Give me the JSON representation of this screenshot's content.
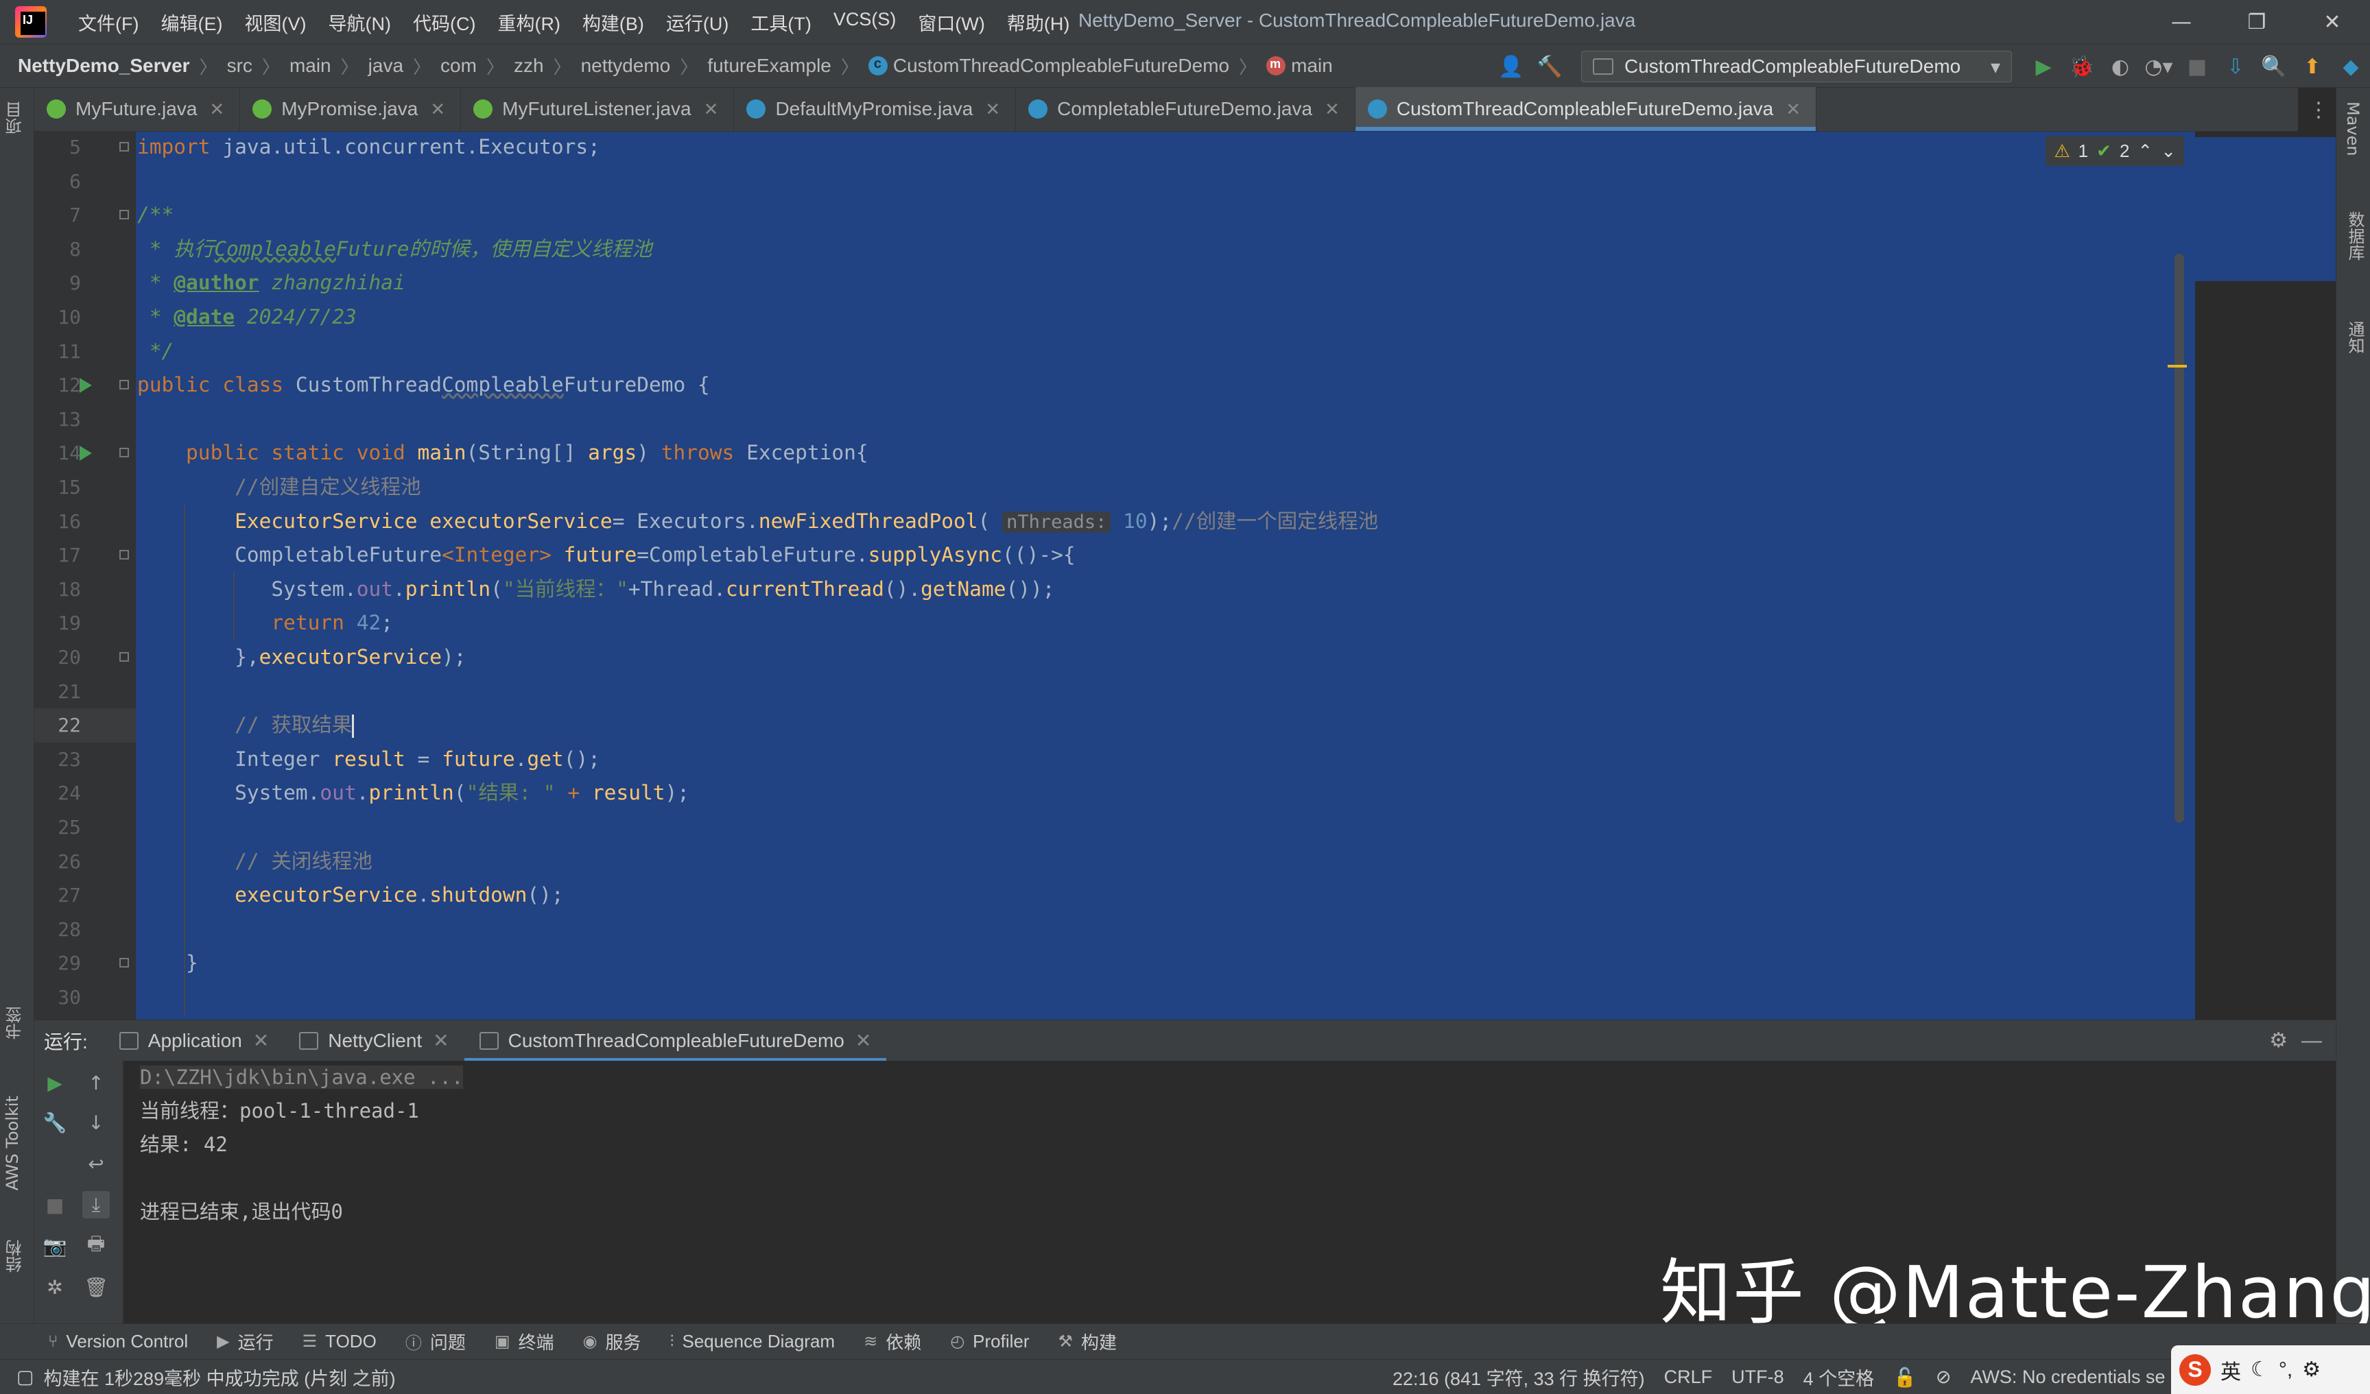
{
  "window": {
    "title": "NettyDemo_Server - CustomThreadCompleableFutureDemo.java",
    "menu": [
      "文件(F)",
      "编辑(E)",
      "视图(V)",
      "导航(N)",
      "代码(C)",
      "重构(R)",
      "构建(B)",
      "运行(U)",
      "工具(T)",
      "VCS(S)",
      "窗口(W)",
      "帮助(H)"
    ],
    "controls": {
      "minimize": "—",
      "restore": "❐",
      "close": "✕"
    }
  },
  "breadcrumb": {
    "project": "NettyDemo_Server",
    "items": [
      "src",
      "main",
      "java",
      "com",
      "zzh",
      "nettydemo",
      "futureExample"
    ],
    "class": "CustomThreadCompleableFutureDemo",
    "method": "main"
  },
  "run_config": {
    "name": "CustomThreadCompleableFutureDemo"
  },
  "tabs": [
    {
      "label": "MyFuture.java",
      "kind": "interface"
    },
    {
      "label": "MyPromise.java",
      "kind": "interface"
    },
    {
      "label": "MyFutureListener.java",
      "kind": "interface"
    },
    {
      "label": "DefaultMyPromise.java",
      "kind": "class"
    },
    {
      "label": "CompletableFutureDemo.java",
      "kind": "class"
    },
    {
      "label": "CustomThreadCompleableFutureDemo.java",
      "kind": "class",
      "active": true
    }
  ],
  "inspections": {
    "warnings": "1",
    "ok": "2"
  },
  "left_strip": {
    "project": "项目",
    "bookmarks": "书签",
    "aws": "AWS Toolkit",
    "structure": "结构"
  },
  "right_strip": {
    "maven": "Maven",
    "database": "数据库",
    "notifications": "通知"
  },
  "editor": {
    "line_numbers": [
      "5",
      "6",
      "7",
      "8",
      "9",
      "10",
      "11",
      "12",
      "13",
      "14",
      "15",
      "16",
      "17",
      "18",
      "19",
      "20",
      "21",
      "22",
      "23",
      "24",
      "25",
      "26",
      "27",
      "28",
      "29",
      "30"
    ],
    "current_line": "22",
    "code": {
      "l5_kw": "import",
      "l5_rest": " java.util.concurrent.Executors;",
      "l7": "/**",
      "l8_a": " * 执行",
      "l8_b": "Compleable",
      "l8_c": "Future的时候，使用自定义线程池",
      "l9_a": " * ",
      "l9_tag": "@author",
      "l9_val": " zhangzhihai",
      "l10_a": " * ",
      "l10_tag": "@date",
      "l10_val": " 2024/7/23",
      "l11": " */",
      "l12_kw": "public class ",
      "l12_a": "CustomThread",
      "l12_b": "Compleable",
      "l12_c": "FutureDemo {",
      "l14_kw1": "public static void ",
      "l14_m": "main",
      "l14_a": "(String[] ",
      "l14_p": "args",
      "l14_b": ") ",
      "l14_kw2": "throws ",
      "l14_c": "Exception{",
      "l15": "//创建自定义线程池",
      "l16_t": "ExecutorService ",
      "l16_v": "executorService",
      "l16_a": "= Executors.",
      "l16_m": "newFixedThreadPool",
      "l16_b": "( ",
      "l16_hint": "nThreads:",
      "l16_n": " 10",
      "l16_c": ");",
      "l16_cmt": "//创建一个固定线程池",
      "l17_a": "CompletableFuture",
      "l17_g": "<Integer> ",
      "l17_v": "future",
      "l17_b": "=CompletableFuture.",
      "l17_m": "supplyAsync",
      "l17_c": "(()->{",
      "l18_a": "System.",
      "l18_f": "out",
      "l18_b": ".",
      "l18_m": "println",
      "l18_c": "(",
      "l18_s": "\"当前线程：\"",
      "l18_d": "+Thread.",
      "l18_m2": "currentThread",
      "l18_e": "().",
      "l18_m3": "getName",
      "l18_f2": "());",
      "l19_kw": "return ",
      "l19_n": "42",
      "l19_e": ";",
      "l20_a": "},",
      "l20_v": "executorService",
      "l20_b": ");",
      "l22": "// 获取结果",
      "l23_a": "Integer ",
      "l23_v": "result",
      "l23_b": " = ",
      "l23_v2": "future",
      "l23_c": ".",
      "l23_m": "get",
      "l23_d": "();",
      "l24_a": "System.",
      "l24_f": "out",
      "l24_b": ".",
      "l24_m": "println",
      "l24_c": "(",
      "l24_s": "\"结果: \"",
      "l24_d": " + ",
      "l24_v": "result",
      "l24_e": ");",
      "l26": "// 关闭线程池",
      "l27_v": "executorService",
      "l27_a": ".",
      "l27_m": "shutdown",
      "l27_b": "();",
      "l29": "}"
    }
  },
  "run_panel": {
    "label": "运行:",
    "tabs": [
      "Application",
      "NettyClient",
      "CustomThreadCompleableFutureDemo"
    ],
    "console": [
      "D:\\ZZH\\jdk\\bin\\java.exe ...",
      "当前线程：pool-1-thread-1",
      "结果: 42",
      "",
      "进程已结束,退出代码0"
    ]
  },
  "tool_windows": [
    "Version Control",
    "运行",
    "TODO",
    "问题",
    "终端",
    "服务",
    "Sequence Diagram",
    "依赖",
    "Profiler",
    "构建"
  ],
  "status": {
    "message": "构建在 1秒289毫秒 中成功完成 (片刻 之前)",
    "position": "22:16 (841 字符, 33 行 换行符)",
    "line_sep": "CRLF",
    "encoding": "UTF-8",
    "indent": "4 个空格",
    "aws": "AWS: No credentials se"
  },
  "ime": {
    "lang": "英"
  },
  "watermark": "知乎 @Matte-Zhang"
}
